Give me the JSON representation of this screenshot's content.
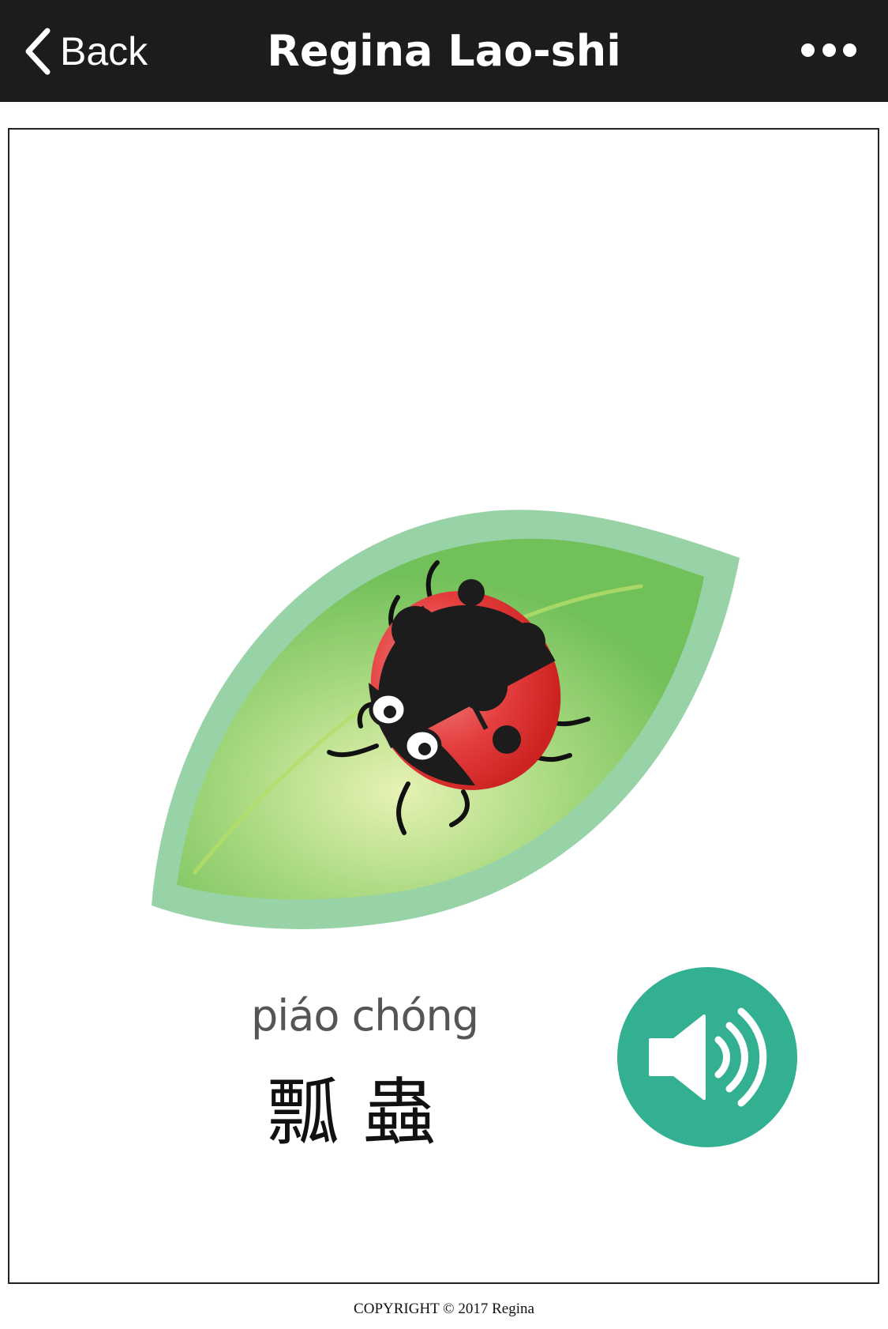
{
  "navbar": {
    "back_label": "Back",
    "title": "Regina Lao-shi",
    "back_icon": "chevron-left-icon",
    "more_icon": "more-dots-icon"
  },
  "card": {
    "illustration": "ladybug-on-leaf",
    "pinyin": "piáo chóng",
    "hanzi": "瓢蟲",
    "speaker_icon": "speaker-volume-icon",
    "speaker_color": "#33b091"
  },
  "footer": {
    "copyright": "COPYRIGHT © 2017 Regina"
  },
  "colors": {
    "navbar_bg": "#1c1c1e",
    "leaf_outer": "#98d3a8",
    "leaf_inner": "#76c35a",
    "ladybug_red": "#e23a3a"
  }
}
